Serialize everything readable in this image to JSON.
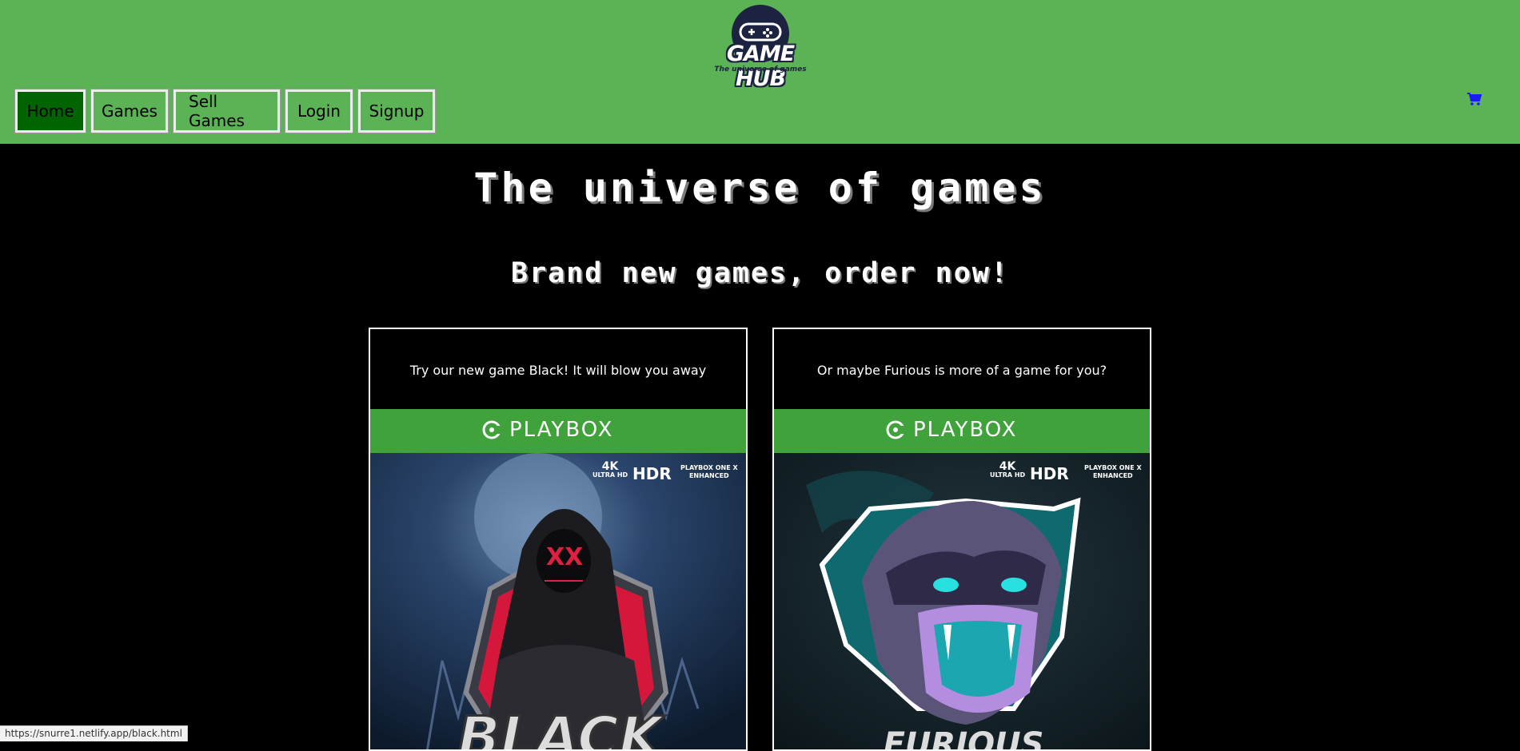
{
  "brand": {
    "name": "GAME HUB",
    "tagline": "The universe of games"
  },
  "nav": {
    "items": [
      {
        "label": "Home",
        "active": true
      },
      {
        "label": "Games",
        "active": false
      },
      {
        "label": "Sell Games",
        "active": false
      },
      {
        "label": "Login",
        "active": false
      },
      {
        "label": "Signup",
        "active": false
      }
    ],
    "cart_icon": "shopping-cart-icon"
  },
  "hero": {
    "title": "The universe of games",
    "subtitle": "Brand new games, order now!"
  },
  "cards": [
    {
      "caption": "Try our new game Black! It will blow you away",
      "band_label": "PLAYBOX",
      "badges": {
        "k4": "4K",
        "k4_sub": "ULTRA HD",
        "hdr": "HDR",
        "xline1": "PLAYBOX ONE X",
        "xline2": "ENHANCED"
      },
      "cover_title": "BLACK"
    },
    {
      "caption": "Or maybe Furious is more of a game for you?",
      "band_label": "PLAYBOX",
      "badges": {
        "k4": "4K",
        "k4_sub": "ULTRA HD",
        "hdr": "HDR",
        "xline1": "PLAYBOX ONE X",
        "xline2": "ENHANCED"
      },
      "cover_title": "FURIOUS"
    }
  ],
  "status_bar": {
    "url": "https://snurre1.netlify.app/black.html"
  },
  "colors": {
    "header_bg": "#5cb356",
    "nav_active": "#006400",
    "page_bg": "#000000",
    "band_green": "#3fa23a",
    "cart_blue": "#1a1aff"
  }
}
